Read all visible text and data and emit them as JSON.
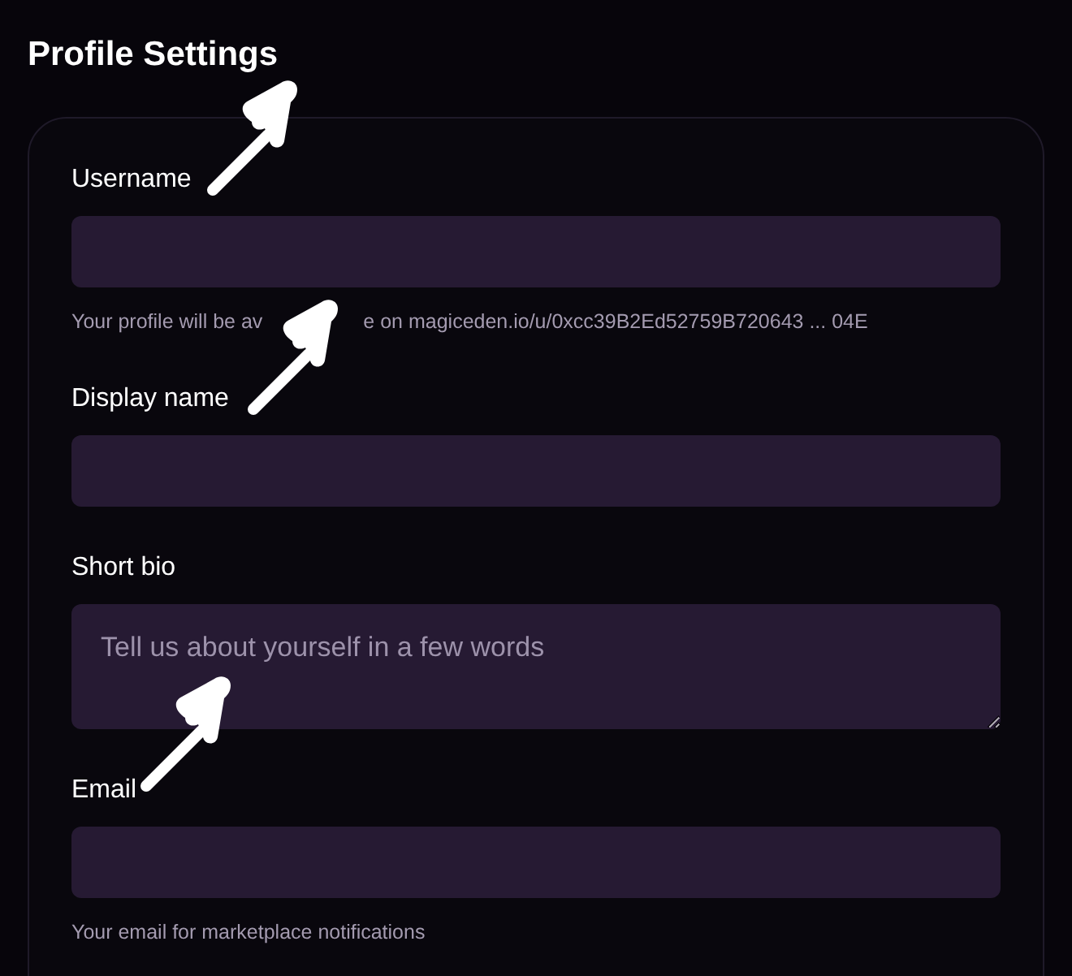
{
  "title": "Profile Settings",
  "fields": [
    {
      "kind": "input",
      "label": "Username",
      "help": [
        "Your profile will be av",
        "e on magiceden.io/u/0xcc39B2Ed52759B720643 ... 04E"
      ]
    },
    {
      "kind": "input",
      "label": "Display name"
    },
    {
      "kind": "textarea",
      "label": "Short bio",
      "placeholder": "Tell us about yourself in a few words"
    },
    {
      "kind": "input",
      "label": "Email",
      "help": [
        "Your email for marketplace notifications"
      ]
    }
  ]
}
